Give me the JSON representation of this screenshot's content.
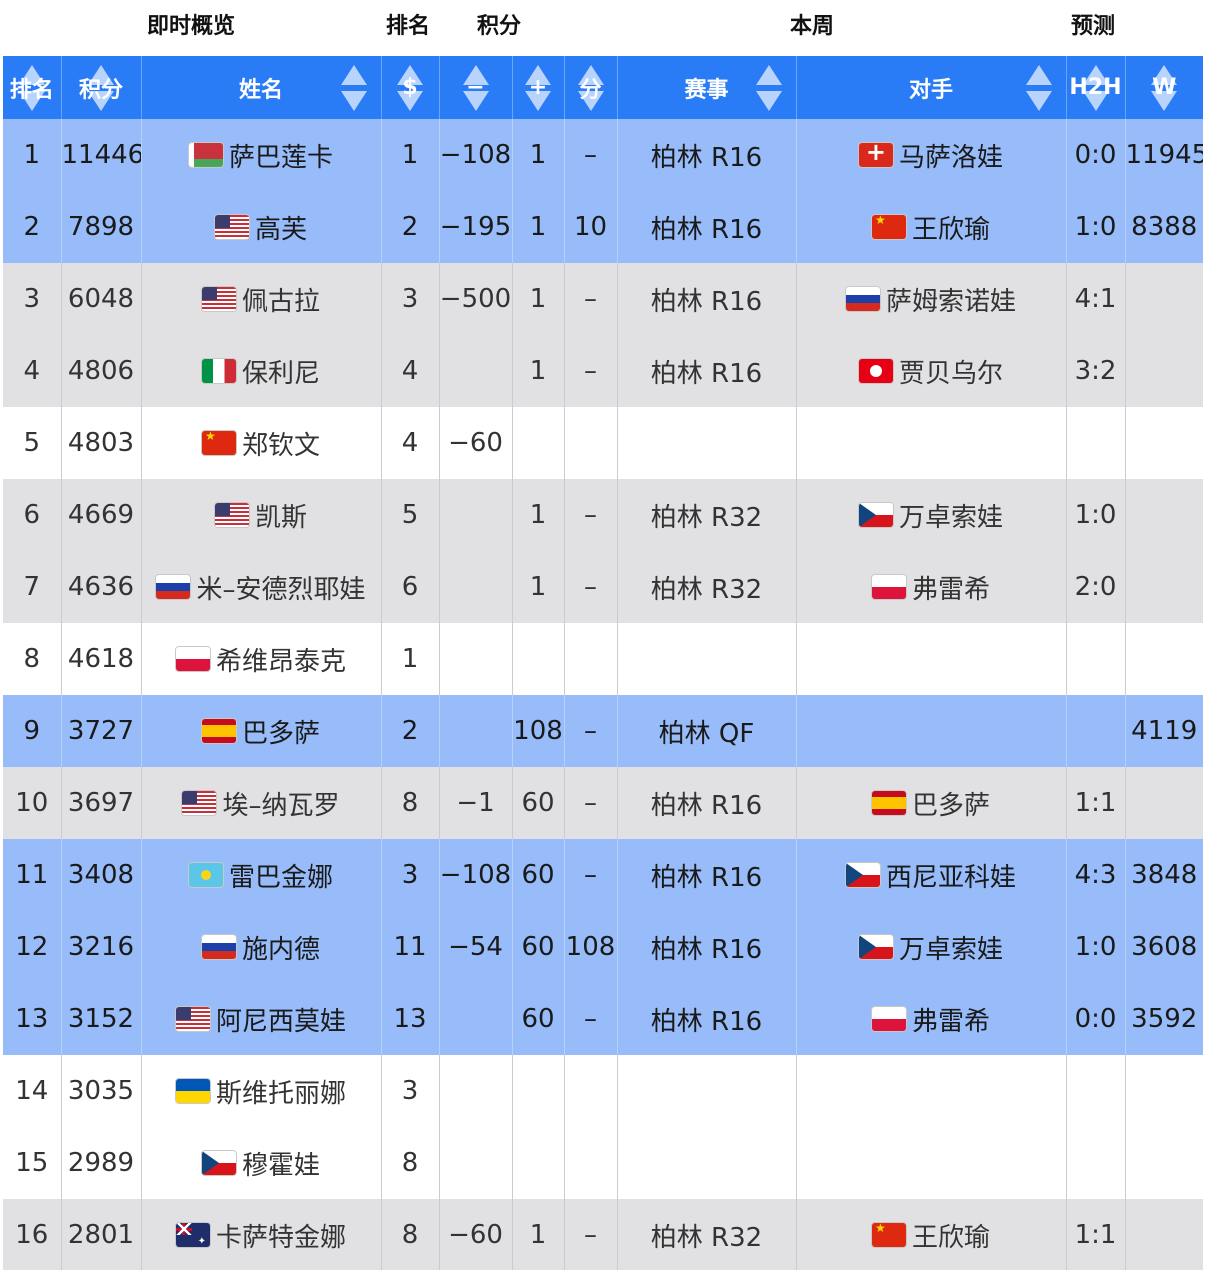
{
  "top_headers": [
    {
      "key": "overview",
      "label": "即时概览"
    },
    {
      "key": "rank",
      "label": "排名"
    },
    {
      "key": "points",
      "label": "积分"
    },
    {
      "key": "week",
      "label": "本周"
    },
    {
      "key": "forecast",
      "label": "预测"
    }
  ],
  "columns": [
    {
      "key": "rank",
      "label": "排名"
    },
    {
      "key": "points",
      "label": "积分"
    },
    {
      "key": "name",
      "label": "姓名"
    },
    {
      "key": "rank_change",
      "label": "$"
    },
    {
      "key": "minus",
      "label": "−"
    },
    {
      "key": "plus",
      "label": "+"
    },
    {
      "key": "score",
      "label": "分"
    },
    {
      "key": "event",
      "label": "赛事"
    },
    {
      "key": "opponent",
      "label": "对手"
    },
    {
      "key": "h2h",
      "label": "H2H"
    },
    {
      "key": "w",
      "label": "W"
    }
  ],
  "colors": {
    "header_blue": "#2a7cf6",
    "row_blue": "#97bcf9",
    "row_grey": "#e1e1e3",
    "row_white": "#ffffff"
  },
  "rows": [
    {
      "style": "blue",
      "rank": "1",
      "points": "11446",
      "flag": "by",
      "name": "萨巴莲卡",
      "rank_change": "1",
      "minus": "−108",
      "plus": "1",
      "score": "–",
      "event": "柏林 R16",
      "opp_flag": "ch",
      "opponent": "马萨洛娃",
      "h2h": "0:0",
      "w": "11945"
    },
    {
      "style": "blue",
      "rank": "2",
      "points": "7898",
      "flag": "us",
      "name": "高芙",
      "rank_change": "2",
      "minus": "−195",
      "plus": "1",
      "score": "10",
      "event": "柏林 R16",
      "opp_flag": "cn",
      "opponent": "王欣瑜",
      "h2h": "1:0",
      "w": "8388"
    },
    {
      "style": "grey",
      "rank": "3",
      "points": "6048",
      "flag": "us",
      "name": "佩古拉",
      "rank_change": "3",
      "minus": "−500",
      "plus": "1",
      "score": "–",
      "event": "柏林 R16",
      "opp_flag": "ru",
      "opponent": "萨姆索诺娃",
      "h2h": "4:1",
      "w": ""
    },
    {
      "style": "grey",
      "rank": "4",
      "points": "4806",
      "flag": "it",
      "name": "保利尼",
      "rank_change": "4",
      "minus": "",
      "plus": "1",
      "score": "–",
      "event": "柏林 R16",
      "opp_flag": "tn",
      "opponent": "贾贝乌尔",
      "h2h": "3:2",
      "w": ""
    },
    {
      "style": "white",
      "rank": "5",
      "points": "4803",
      "flag": "cn",
      "name": "郑钦文",
      "rank_change": "4",
      "minus": "−60",
      "plus": "",
      "score": "",
      "event": "",
      "opp_flag": "",
      "opponent": "",
      "h2h": "",
      "w": ""
    },
    {
      "style": "grey",
      "rank": "6",
      "points": "4669",
      "flag": "us",
      "name": "凯斯",
      "rank_change": "5",
      "minus": "",
      "plus": "1",
      "score": "–",
      "event": "柏林 R32",
      "opp_flag": "cz",
      "opponent": "万卓索娃",
      "h2h": "1:0",
      "w": ""
    },
    {
      "style": "grey",
      "rank": "7",
      "points": "4636",
      "flag": "ru",
      "name": "米–安德烈耶娃",
      "rank_change": "6",
      "minus": "",
      "plus": "1",
      "score": "–",
      "event": "柏林 R32",
      "opp_flag": "pl",
      "opponent": "弗雷希",
      "h2h": "2:0",
      "w": ""
    },
    {
      "style": "white",
      "rank": "8",
      "points": "4618",
      "flag": "pl",
      "name": "希维昂泰克",
      "rank_change": "1",
      "minus": "",
      "plus": "",
      "score": "",
      "event": "",
      "opp_flag": "",
      "opponent": "",
      "h2h": "",
      "w": ""
    },
    {
      "style": "blue",
      "rank": "9",
      "points": "3727",
      "flag": "es",
      "name": "巴多萨",
      "rank_change": "2",
      "minus": "",
      "plus": "108",
      "score": "–",
      "event": "柏林 QF",
      "opp_flag": "",
      "opponent": "",
      "h2h": "",
      "w": "4119"
    },
    {
      "style": "grey",
      "rank": "10",
      "points": "3697",
      "flag": "us",
      "name": "埃–纳瓦罗",
      "rank_change": "8",
      "minus": "−1",
      "plus": "60",
      "score": "–",
      "event": "柏林 R16",
      "opp_flag": "es",
      "opponent": "巴多萨",
      "h2h": "1:1",
      "w": ""
    },
    {
      "style": "blue",
      "rank": "11",
      "points": "3408",
      "flag": "kz",
      "name": "雷巴金娜",
      "rank_change": "3",
      "minus": "−108",
      "plus": "60",
      "score": "–",
      "event": "柏林 R16",
      "opp_flag": "cz",
      "opponent": "西尼亚科娃",
      "h2h": "4:3",
      "w": "3848"
    },
    {
      "style": "blue",
      "rank": "12",
      "points": "3216",
      "flag": "ru",
      "name": "施内德",
      "rank_change": "11",
      "minus": "−54",
      "plus": "60",
      "score": "108",
      "event": "柏林 R16",
      "opp_flag": "cz",
      "opponent": "万卓索娃",
      "h2h": "1:0",
      "w": "3608"
    },
    {
      "style": "blue",
      "rank": "13",
      "points": "3152",
      "flag": "us",
      "name": "阿尼西莫娃",
      "rank_change": "13",
      "minus": "",
      "plus": "60",
      "score": "–",
      "event": "柏林 R16",
      "opp_flag": "pl",
      "opponent": "弗雷希",
      "h2h": "0:0",
      "w": "3592"
    },
    {
      "style": "white",
      "rank": "14",
      "points": "3035",
      "flag": "ua",
      "name": "斯维托丽娜",
      "rank_change": "3",
      "minus": "",
      "plus": "",
      "score": "",
      "event": "",
      "opp_flag": "",
      "opponent": "",
      "h2h": "",
      "w": ""
    },
    {
      "style": "white",
      "rank": "15",
      "points": "2989",
      "flag": "cz",
      "name": "穆霍娃",
      "rank_change": "8",
      "minus": "",
      "plus": "",
      "score": "",
      "event": "",
      "opp_flag": "",
      "opponent": "",
      "h2h": "",
      "w": ""
    },
    {
      "style": "grey",
      "rank": "16",
      "points": "2801",
      "flag": "au",
      "name": "卡萨特金娜",
      "rank_change": "8",
      "minus": "−60",
      "plus": "1",
      "score": "–",
      "event": "柏林 R32",
      "opp_flag": "cn",
      "opponent": "王欣瑜",
      "h2h": "1:1",
      "w": ""
    }
  ]
}
